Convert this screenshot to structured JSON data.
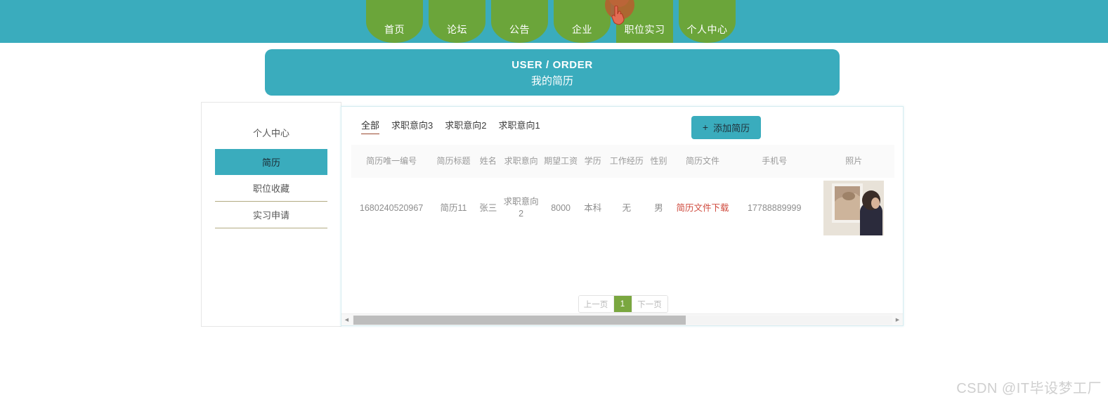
{
  "theme": {
    "teal": "#3aacbd",
    "green": "#6ba53a",
    "pager_green": "#7aa740",
    "link_red": "#cf4a3d",
    "tab_underline": "#9b4a2f",
    "sidebar_separator": "#b3ab82"
  },
  "topnav": {
    "items": [
      {
        "label": "首页",
        "active": false
      },
      {
        "label": "论坛",
        "active": false
      },
      {
        "label": "公告",
        "active": false
      },
      {
        "label": "企业",
        "active": false
      },
      {
        "label": "职位实习",
        "active": true
      },
      {
        "label": "个人中心",
        "active": false
      }
    ]
  },
  "banner": {
    "title_en": "USER / ORDER",
    "title_cn": "我的简历"
  },
  "sidebar": {
    "heading": "个人中心",
    "items": [
      {
        "label": "简历",
        "active": true
      },
      {
        "label": "职位收藏",
        "active": false
      },
      {
        "label": "实习申请",
        "active": false
      }
    ]
  },
  "content": {
    "tabs": [
      {
        "label": "全部",
        "active": true
      },
      {
        "label": "求职意向3",
        "active": false
      },
      {
        "label": "求职意向2",
        "active": false
      },
      {
        "label": "求职意向1",
        "active": false
      }
    ],
    "add_button": {
      "plus": "+",
      "label": "添加简历"
    },
    "corner_marker": "-",
    "table": {
      "columns": [
        "简历唯一编号",
        "简历标题",
        "姓名",
        "求职意向",
        "期望工资",
        "学历",
        "工作经历",
        "性别",
        "简历文件",
        "手机号",
        "照片"
      ],
      "rows": [
        {
          "id": "1680240520967",
          "title": "简历11",
          "name": "张三",
          "intention": "求职意向2",
          "salary": "8000",
          "education": "本科",
          "experience": "无",
          "gender": "男",
          "file_link": "简历文件下载",
          "phone": "17788889999",
          "photo_alt": "照片"
        }
      ]
    },
    "pagination": {
      "prev": "上一页",
      "current": "1",
      "next": "下一页"
    }
  },
  "watermark": "CSDN @IT毕设梦工厂"
}
